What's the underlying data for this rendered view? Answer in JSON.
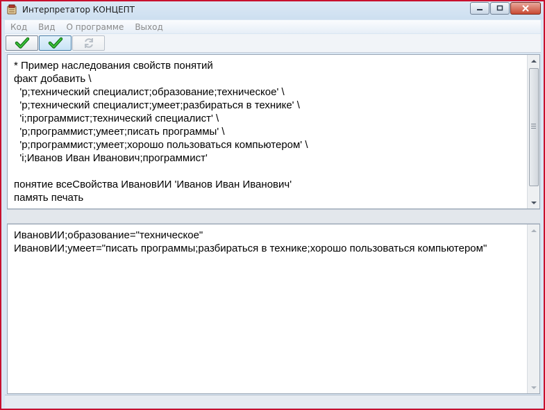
{
  "window": {
    "title": "Интерпретатор КОНЦЕПТ",
    "app_icon": "concept-app-icon",
    "caption_buttons": [
      "minimize-icon",
      "maximize-icon",
      "close-icon"
    ]
  },
  "menu": {
    "items": [
      {
        "label": "Код"
      },
      {
        "label": "Вид"
      },
      {
        "label": "О программе"
      },
      {
        "label": "Выход"
      }
    ]
  },
  "toolbar": {
    "buttons": [
      {
        "icon": "checkmark-icon",
        "state": "normal"
      },
      {
        "icon": "checkmark-icon",
        "state": "active"
      },
      {
        "icon": "refresh-icon",
        "state": "disabled"
      }
    ]
  },
  "editor": {
    "code": "* Пример наследования свойств понятий\nфакт добавить \\\n  'р;технический специалист;образование;техническое' \\\n  'р;технический специалист;умеет;разбираться в технике' \\\n  'i;программист;технический специалист' \\\n  'р;программист;умеет;писать программы' \\\n  'р;программист;умеет;хорошо пользоваться компьютером' \\\n  'i;Иванов Иван Иванович;программист'\n\nпонятие всеСвойства ИвановИИ 'Иванов Иван Иванович'\nпамять печать"
  },
  "output": {
    "text": "ИвановИИ;образование=\"техническое\"\nИвановИИ;умеет=\"писать программы;разбираться в технике;хорошо пользоваться компьютером\""
  },
  "colors": {
    "frame": "#c8102e",
    "check_green": "#1f9a1f"
  }
}
